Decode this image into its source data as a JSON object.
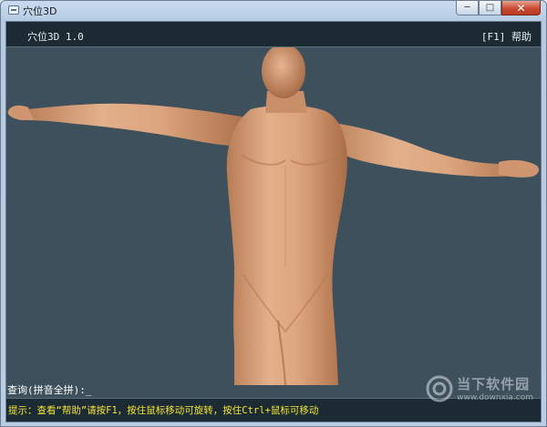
{
  "window": {
    "title": "穴位3D",
    "controls": {
      "minimize": "─",
      "maximize": "□",
      "close": "✕"
    }
  },
  "app": {
    "title": "穴位3D 1.0",
    "help_label": "[F1] 帮助"
  },
  "viewport": {
    "background_color": "#3e505c",
    "skin_color": "#d9a47c"
  },
  "query": {
    "label": "查询(拼音全拼):",
    "value": "_"
  },
  "hint": {
    "text": "提示：查看“帮助”请按F1，按住鼠标移动可旋转，按住Ctrl+鼠标可移动"
  },
  "watermark": {
    "name": "当下软件园",
    "url": "www.downxia.com"
  }
}
